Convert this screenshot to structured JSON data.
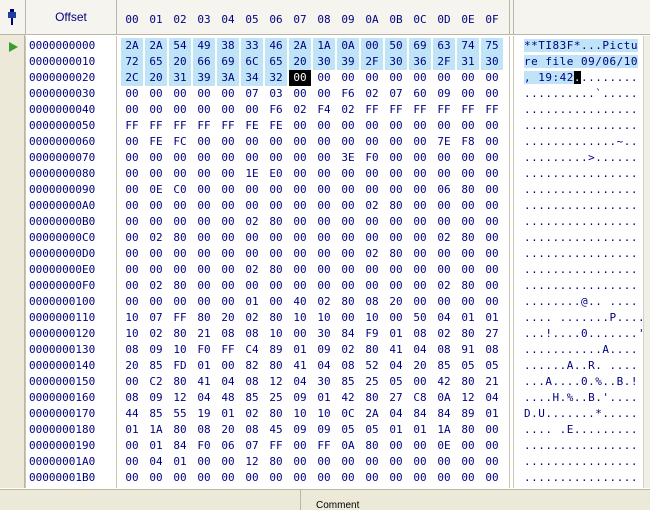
{
  "header": {
    "offset_label": "Offset",
    "columns": [
      "00",
      "01",
      "02",
      "03",
      "04",
      "05",
      "06",
      "07",
      "08",
      "09",
      "0A",
      "0B",
      "0C",
      "0D",
      "0E",
      "0F"
    ]
  },
  "rows": [
    {
      "offset": "0000000000",
      "hex": [
        "2A",
        "2A",
        "54",
        "49",
        "38",
        "33",
        "46",
        "2A",
        "1A",
        "0A",
        "00",
        "50",
        "69",
        "63",
        "74",
        "75"
      ],
      "ascii": "**TI83F*...Pictu"
    },
    {
      "offset": "0000000010",
      "hex": [
        "72",
        "65",
        "20",
        "66",
        "69",
        "6C",
        "65",
        "20",
        "30",
        "39",
        "2F",
        "30",
        "36",
        "2F",
        "31",
        "30"
      ],
      "ascii": "re file 09/06/10"
    },
    {
      "offset": "0000000020",
      "hex": [
        "2C",
        "20",
        "31",
        "39",
        "3A",
        "34",
        "32",
        "00",
        "00",
        "00",
        "00",
        "00",
        "00",
        "00",
        "00",
        "00"
      ],
      "ascii": ", 19:42........."
    },
    {
      "offset": "0000000030",
      "hex": [
        "00",
        "00",
        "00",
        "00",
        "00",
        "07",
        "03",
        "00",
        "00",
        "F6",
        "02",
        "07",
        "60",
        "09",
        "00",
        "00"
      ],
      "ascii": "..........`....."
    },
    {
      "offset": "0000000040",
      "hex": [
        "00",
        "00",
        "00",
        "00",
        "00",
        "00",
        "F6",
        "02",
        "F4",
        "02",
        "FF",
        "FF",
        "FF",
        "FF",
        "FF",
        "FF"
      ],
      "ascii": "................"
    },
    {
      "offset": "0000000050",
      "hex": [
        "FF",
        "FF",
        "FF",
        "FF",
        "FF",
        "FE",
        "FE",
        "00",
        "00",
        "00",
        "00",
        "00",
        "00",
        "00",
        "00",
        "00"
      ],
      "ascii": "................"
    },
    {
      "offset": "0000000060",
      "hex": [
        "00",
        "FE",
        "FC",
        "00",
        "00",
        "00",
        "00",
        "00",
        "00",
        "00",
        "00",
        "00",
        "00",
        "7E",
        "F8",
        "00"
      ],
      "ascii": ".............~.."
    },
    {
      "offset": "0000000070",
      "hex": [
        "00",
        "00",
        "00",
        "00",
        "00",
        "00",
        "00",
        "00",
        "00",
        "3E",
        "F0",
        "00",
        "00",
        "00",
        "00",
        "00"
      ],
      "ascii": ".........>......"
    },
    {
      "offset": "0000000080",
      "hex": [
        "00",
        "00",
        "00",
        "00",
        "00",
        "1E",
        "E0",
        "00",
        "00",
        "00",
        "00",
        "00",
        "00",
        "00",
        "00",
        "00"
      ],
      "ascii": "................"
    },
    {
      "offset": "0000000090",
      "hex": [
        "00",
        "0E",
        "C0",
        "00",
        "00",
        "00",
        "00",
        "00",
        "00",
        "00",
        "00",
        "00",
        "00",
        "06",
        "80",
        "00"
      ],
      "ascii": "................"
    },
    {
      "offset": "00000000A0",
      "hex": [
        "00",
        "00",
        "00",
        "00",
        "00",
        "00",
        "00",
        "00",
        "00",
        "00",
        "02",
        "80",
        "00",
        "00",
        "00",
        "00"
      ],
      "ascii": "................"
    },
    {
      "offset": "00000000B0",
      "hex": [
        "00",
        "00",
        "00",
        "00",
        "00",
        "02",
        "80",
        "00",
        "00",
        "00",
        "00",
        "00",
        "00",
        "00",
        "00",
        "00"
      ],
      "ascii": "................"
    },
    {
      "offset": "00000000C0",
      "hex": [
        "00",
        "02",
        "80",
        "00",
        "00",
        "00",
        "00",
        "00",
        "00",
        "00",
        "00",
        "00",
        "00",
        "02",
        "80",
        "00"
      ],
      "ascii": "................"
    },
    {
      "offset": "00000000D0",
      "hex": [
        "00",
        "00",
        "00",
        "00",
        "00",
        "00",
        "00",
        "00",
        "00",
        "00",
        "02",
        "80",
        "00",
        "00",
        "00",
        "00"
      ],
      "ascii": "................"
    },
    {
      "offset": "00000000E0",
      "hex": [
        "00",
        "00",
        "00",
        "00",
        "00",
        "02",
        "80",
        "00",
        "00",
        "00",
        "00",
        "00",
        "00",
        "00",
        "00",
        "00"
      ],
      "ascii": "................"
    },
    {
      "offset": "00000000F0",
      "hex": [
        "00",
        "02",
        "80",
        "00",
        "00",
        "00",
        "00",
        "00",
        "00",
        "00",
        "00",
        "00",
        "00",
        "02",
        "80",
        "00"
      ],
      "ascii": "................"
    },
    {
      "offset": "0000000100",
      "hex": [
        "00",
        "00",
        "00",
        "00",
        "00",
        "01",
        "00",
        "40",
        "02",
        "80",
        "08",
        "20",
        "00",
        "00",
        "00",
        "00"
      ],
      "ascii": "........@.. ...."
    },
    {
      "offset": "0000000110",
      "hex": [
        "10",
        "07",
        "FF",
        "80",
        "20",
        "02",
        "80",
        "10",
        "10",
        "00",
        "10",
        "00",
        "50",
        "04",
        "01",
        "01"
      ],
      "ascii": ".... .......P...."
    },
    {
      "offset": "0000000120",
      "hex": [
        "10",
        "02",
        "80",
        "21",
        "08",
        "08",
        "10",
        "00",
        "30",
        "84",
        "F9",
        "01",
        "08",
        "02",
        "80",
        "27"
      ],
      "ascii": "...!....0.......'"
    },
    {
      "offset": "0000000130",
      "hex": [
        "08",
        "09",
        "10",
        "F0",
        "FF",
        "C4",
        "89",
        "01",
        "09",
        "02",
        "80",
        "41",
        "04",
        "08",
        "91",
        "08"
      ],
      "ascii": "...........A...."
    },
    {
      "offset": "0000000140",
      "hex": [
        "20",
        "85",
        "FD",
        "01",
        "00",
        "82",
        "80",
        "41",
        "04",
        "08",
        "52",
        "04",
        "20",
        "85",
        "05",
        "05"
      ],
      "ascii": " ......A..R. ...."
    },
    {
      "offset": "0000000150",
      "hex": [
        "00",
        "C2",
        "80",
        "41",
        "04",
        "08",
        "12",
        "04",
        "30",
        "85",
        "25",
        "05",
        "00",
        "42",
        "80",
        "21"
      ],
      "ascii": "...A....0.%..B.!"
    },
    {
      "offset": "0000000160",
      "hex": [
        "08",
        "09",
        "12",
        "04",
        "48",
        "85",
        "25",
        "09",
        "01",
        "42",
        "80",
        "27",
        "C8",
        "0A",
        "12",
        "04"
      ],
      "ascii": "....H.%..B.'...."
    },
    {
      "offset": "0000000170",
      "hex": [
        "44",
        "85",
        "55",
        "19",
        "01",
        "02",
        "80",
        "10",
        "10",
        "0C",
        "2A",
        "04",
        "84",
        "84",
        "89",
        "01"
      ],
      "ascii": "D.U.......*....."
    },
    {
      "offset": "0000000180",
      "hex": [
        "01",
        "1A",
        "80",
        "08",
        "20",
        "08",
        "45",
        "09",
        "09",
        "05",
        "05",
        "01",
        "01",
        "1A",
        "80",
        "00"
      ],
      "ascii": ".... .E........."
    },
    {
      "offset": "0000000190",
      "hex": [
        "00",
        "01",
        "84",
        "F0",
        "06",
        "07",
        "FF",
        "00",
        "FF",
        "0A",
        "80",
        "00",
        "00",
        "0E",
        "00",
        "00"
      ],
      "ascii": "................"
    },
    {
      "offset": "00000001A0",
      "hex": [
        "00",
        "04",
        "01",
        "00",
        "00",
        "12",
        "80",
        "00",
        "00",
        "00",
        "00",
        "00",
        "00",
        "00",
        "00",
        "00"
      ],
      "ascii": "................"
    },
    {
      "offset": "00000001B0",
      "hex": [
        "00",
        "00",
        "00",
        "00",
        "00",
        "00",
        "00",
        "00",
        "00",
        "00",
        "00",
        "00",
        "00",
        "00",
        "00",
        "00"
      ],
      "ascii": "................"
    }
  ],
  "selection": {
    "start": 0,
    "end": 38,
    "cursor": 39
  },
  "status": {
    "comment_label": "Comment"
  },
  "icons": {
    "pin": "pin-icon",
    "row_marker": "play-arrow-icon"
  },
  "colors": {
    "selection": "#bfe3f7",
    "text": "#000080",
    "cursor": "#000000",
    "marker": "#3c9a2e"
  }
}
